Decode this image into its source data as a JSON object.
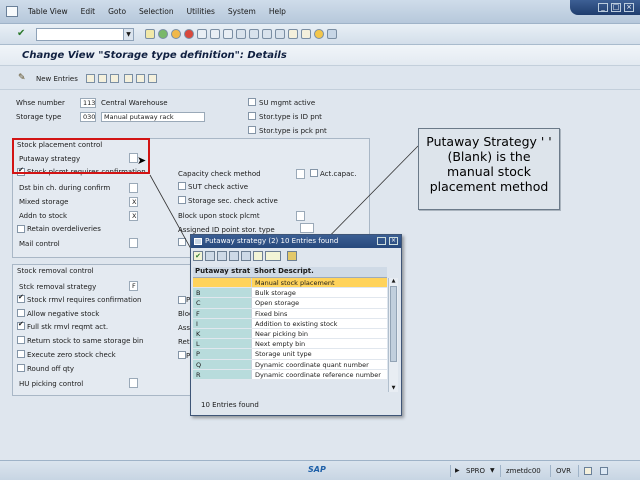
{
  "menubar": {
    "items": [
      "Table View",
      "Edit",
      "Goto",
      "Selection",
      "Utilities",
      "System",
      "Help"
    ]
  },
  "title": "Change View \"Storage type definition\": Details",
  "app_toolbar": {
    "new_entries": "New Entries"
  },
  "header": {
    "whse_number_label": "Whse number",
    "whse_number": "113",
    "whse_name": "Central Warehouse",
    "storage_type_label": "Storage type",
    "storage_type": "030",
    "storage_type_desc": "Manual putaway rack",
    "su_mgmt_label": "SU mgmt active",
    "id_pnt_label": "Stor.type is ID pnt",
    "pck_pnt_label": "Stor.type is pck pnt"
  },
  "placement": {
    "title": "Stock placement control",
    "putaway_strategy_label": "Putaway strategy",
    "stock_plcmt_label": "Stock plcmt requires confirmation",
    "dst_bin_label": "Dst bin ch. during confirm",
    "mixed_storage_label": "Mixed storage",
    "mixed_storage": "X",
    "addn_label": "Addn to stock",
    "addn": "X",
    "retain_label": "Retain overdeliveries",
    "mail_label": "Mail control",
    "capacity_label": "Capacity check method",
    "act_capac_label": "Act.capac.",
    "sut_check_label": "SUT check active",
    "storage_sec_label": "Storage sec. check active",
    "block_label": "Block upon stock plcmt",
    "assigned_id_label": "Assigned ID point stor. type"
  },
  "removal": {
    "title": "Stock removal control",
    "strategy_label": "Stck removal strategy",
    "strategy": "F",
    "confirm_label": "Stock rmvl requires confirmation",
    "negative_label": "Allow negative stock",
    "full_stk_label": "Full stk rmvl reqmt act.",
    "return_label": "Return stock to same storage bin",
    "zero_label": "Execute zero stock check",
    "round_label": "Round off qty",
    "hu_label": "HU picking control",
    "partial_labels": [
      "P",
      "Bloc",
      "Ass",
      "Ret",
      "P"
    ]
  },
  "annotation": {
    "text": "Putaway Strategy ' ' (Blank) is the manual stock placement method"
  },
  "popup": {
    "title": "Putaway strategy (2)   10 Entries found",
    "col1": "Putaway strat",
    "col2": "Short Descript.",
    "rows": [
      {
        "code": "",
        "desc": "Manual stock placement"
      },
      {
        "code": "B",
        "desc": "Bulk storage"
      },
      {
        "code": "C",
        "desc": "Open storage"
      },
      {
        "code": "F",
        "desc": "Fixed bins"
      },
      {
        "code": "I",
        "desc": "Addition to existing stock"
      },
      {
        "code": "K",
        "desc": "Near picking bin"
      },
      {
        "code": "L",
        "desc": "Next empty bin"
      },
      {
        "code": "P",
        "desc": "Storage unit type"
      },
      {
        "code": "Q",
        "desc": "Dynamic coordinate quant number"
      },
      {
        "code": "R",
        "desc": "Dynamic coordinate reference number"
      }
    ],
    "footer": "10 Entries found"
  },
  "statusbar": {
    "sap": "SAP",
    "transaction": "SPRO",
    "server": "zmetdc00",
    "mode": "OVR"
  },
  "colors": {
    "highlight_row": "#ffd35a",
    "callout_border": "#d21414",
    "title_bar": "#27497c"
  }
}
